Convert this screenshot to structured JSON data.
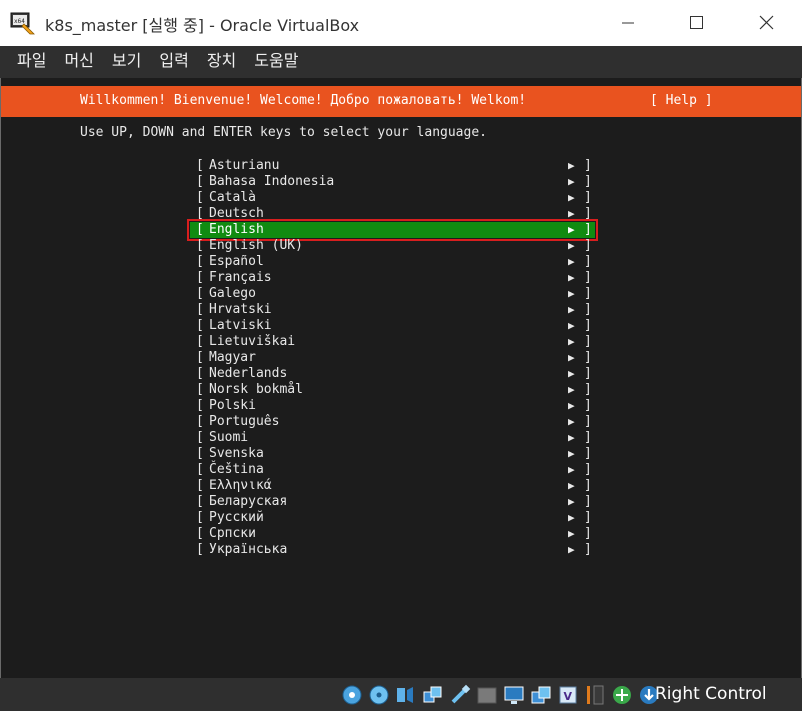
{
  "window": {
    "title": "k8s_master [실행 중] - Oracle VirtualBox"
  },
  "menu": [
    "파일",
    "머신",
    "보기",
    "입력",
    "장치",
    "도움말"
  ],
  "installer": {
    "banner": "Willkommen! Bienvenue! Welcome! Добро пожаловать! Welkom!",
    "help_label": "[ Help ]",
    "instructions": "Use UP, DOWN and ENTER keys to select your language.",
    "selected_language": "English",
    "languages": [
      "Asturianu",
      "Bahasa Indonesia",
      "Català",
      "Deutsch",
      "English",
      "English (UK)",
      "Español",
      "Français",
      "Galego",
      "Hrvatski",
      "Latviski",
      "Lietuviškai",
      "Magyar",
      "Nederlands",
      "Norsk bokmål",
      "Polski",
      "Português",
      "Suomi",
      "Svenska",
      "Čeština",
      "Ελληνικά",
      "Беларуская",
      "Русский",
      "Српски",
      "Українська"
    ]
  },
  "statusbar": {
    "host_key": "Right Control",
    "icons": [
      "hard-disk-icon",
      "optical-drive-icon",
      "audio-icon",
      "network-icon",
      "usb-icon",
      "shared-folders-icon",
      "display-icon",
      "video-capture-icon",
      "cpu-icon",
      "mouse-integration-icon",
      "keyboard-capture-icon"
    ]
  },
  "colors": {
    "banner": "#e9531f",
    "selected_row": "#118b11",
    "highlight_border": "#d81e1e",
    "console_bg": "#1c1c1c",
    "menubar_bg": "#2f2f2f"
  }
}
